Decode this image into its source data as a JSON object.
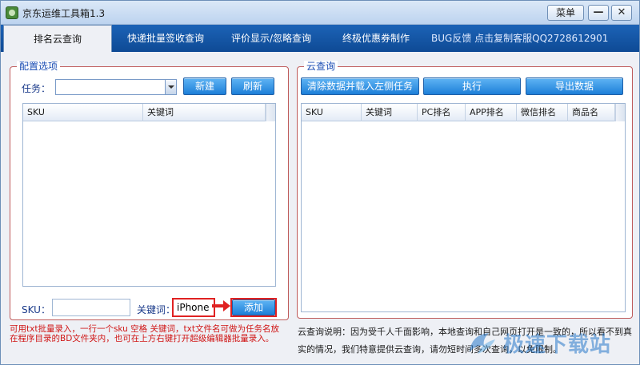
{
  "window": {
    "title": "京东运维工具箱1.3",
    "menu_label": "菜单",
    "min_glyph": "—",
    "close_glyph": "✕"
  },
  "tabs": [
    {
      "label": "排名云查询",
      "active": true
    },
    {
      "label": "快递批量签收查询"
    },
    {
      "label": "评价显示/忽略查询"
    },
    {
      "label": "终极优惠券制作"
    },
    {
      "label": "BUG反馈  点击复制客服QQ2728612901"
    }
  ],
  "left": {
    "group_title": "配置选项",
    "task_label": "任务：",
    "task_value": "",
    "new_button": "新建",
    "refresh_button": "刷新",
    "columns": [
      "SKU",
      "关键词"
    ],
    "sku_label": "SKU：",
    "sku_value": "",
    "keyword_label": "关键词：",
    "keyword_value": "iPhone",
    "add_button": "添加",
    "hint": "可用txt批量录入，一行一个sku 空格 关键词，txt文件名可做为任务名放在程序目录的BD文件夹内，也可在上方右键打开超级编辑器批量录入。"
  },
  "right": {
    "group_title": "云查询",
    "clear_button": "清除数据并载入左侧任务",
    "execute_button": "执行",
    "export_button": "导出数据",
    "columns": [
      "SKU",
      "关键词",
      "PC排名",
      "APP排名",
      "微信排名",
      "商品名"
    ],
    "description": "云查询说明：因为受千人千面影响，本地查询和自己网页打开是一致的，所以看不到真实的情况，我们特意提供云查询，请勿短时间多次查询，以免限制。"
  },
  "watermark": "极速下载站",
  "colors": {
    "tab_bar": "#1c63b7",
    "button": "#1d7fd8",
    "group_border": "#bf5b5b",
    "highlight": "#e02222"
  }
}
